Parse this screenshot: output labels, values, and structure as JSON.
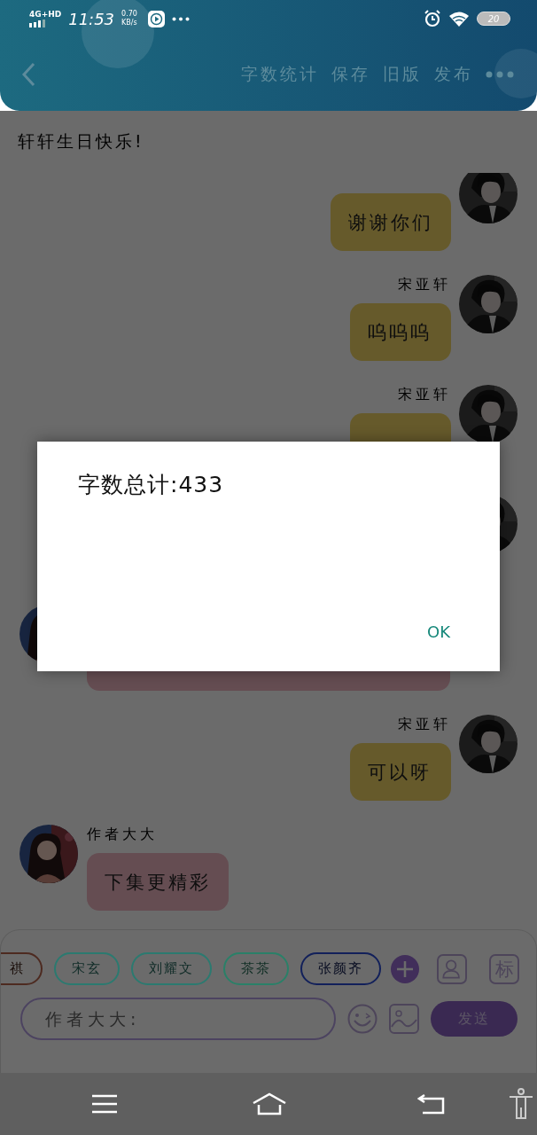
{
  "status_bar": {
    "network": "4G+HD",
    "time": "11:53",
    "speed_value": "0.70",
    "speed_unit": "KB/s",
    "battery": "20"
  },
  "header": {
    "actions": [
      "字数统计",
      "保存",
      "旧版",
      "发布"
    ]
  },
  "story_title": "轩轩生日快乐!",
  "messages": [
    {
      "kind": "outgoing",
      "text": "谢谢你们"
    },
    {
      "kind": "outgoing",
      "name": "宋亚轩",
      "text": "呜呜呜"
    },
    {
      "kind": "outgoing",
      "name": "宋亚轩"
    },
    {
      "kind": "outgoing"
    },
    {
      "kind": "incoming"
    },
    {
      "kind": "outgoing",
      "name": "宋亚轩",
      "text": "可以呀"
    },
    {
      "kind": "incoming",
      "name": "作者大大",
      "text": "下集更精彩"
    }
  ],
  "characters": [
    {
      "name": "祺",
      "color": "#4d2a20"
    },
    {
      "name": "宋玄",
      "color": "#2b7a70"
    },
    {
      "name": "刘耀文",
      "color": "#2b7a70"
    },
    {
      "name": "茶茶",
      "color": "#2a8068"
    },
    {
      "name": "张颜齐",
      "color": "#12205a"
    }
  ],
  "composer": {
    "tag_button": "标",
    "placeholder": "作者大大:",
    "send_button": "发送"
  },
  "dialog": {
    "message": "字数总计:433",
    "ok": "OK"
  }
}
